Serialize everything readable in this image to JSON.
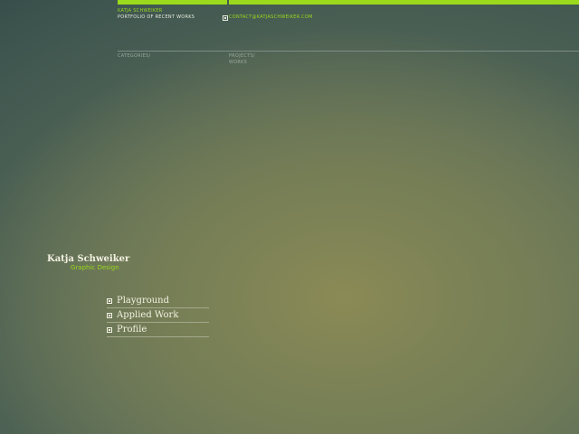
{
  "header": {
    "owner": "KATJA SCHWEIKER",
    "tagline": "PORTFOLIO OF RECENT WORKS",
    "contact": "CONTACT@KATJASCHWEIKER.COM"
  },
  "nav": {
    "categories": "CATEGORIES/",
    "projects": "PROJECTS/",
    "works": "WORKS"
  },
  "identity": {
    "name": "Katja Schweiker",
    "role": "Graphic Design"
  },
  "menu": {
    "items": [
      {
        "label": "Playground"
      },
      {
        "label": "Applied Work"
      },
      {
        "label": "Profile"
      }
    ]
  },
  "colors": {
    "accent": "#9ad91c",
    "text": "#f3f1e2"
  }
}
